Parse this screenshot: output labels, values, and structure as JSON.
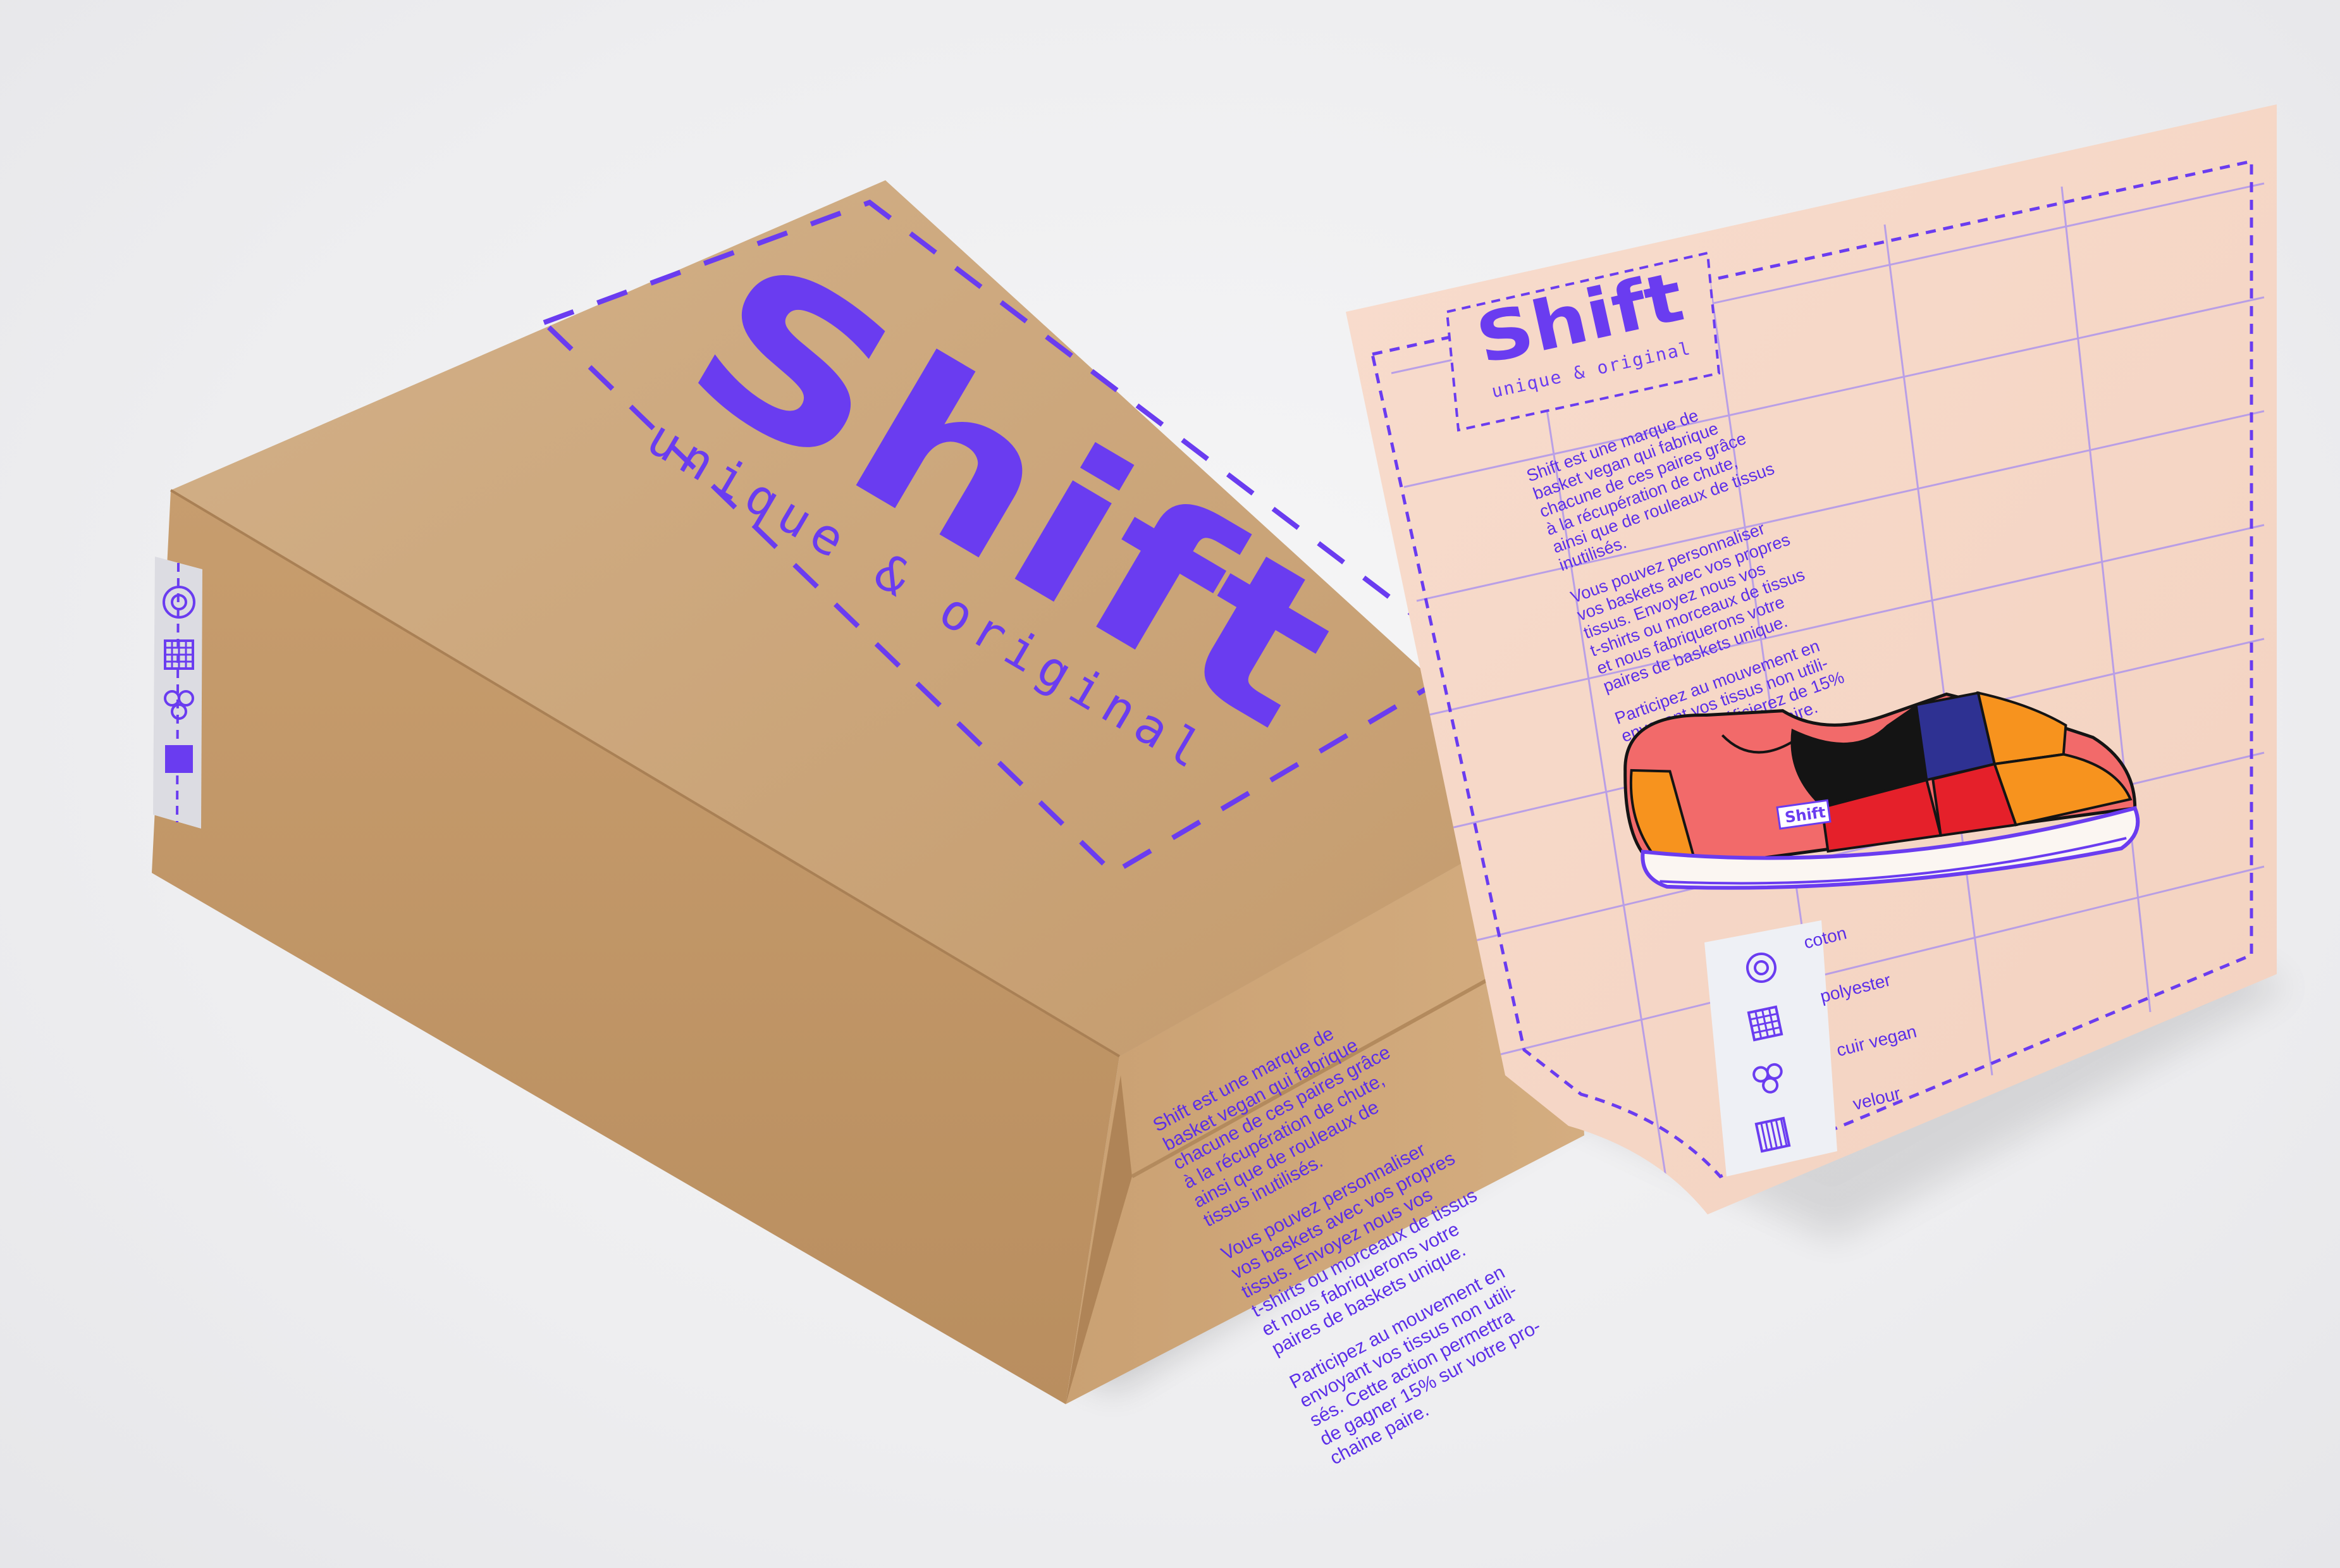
{
  "brand": {
    "name": "Shift",
    "tagline": "unique & original"
  },
  "box": {
    "side_text_paragraphs": [
      [
        "Shift est une marque de",
        "basket vegan qui fabrique",
        "chacune de ces paires grâce",
        "à la récupération de chute,",
        "ainsi que de rouleaux de",
        "tissus inutilisés."
      ],
      [
        "Vous pouvez personnaliser",
        "vos baskets avec vos propres",
        "tissus. Envoyez nous vos",
        "t-shirts ou morceaux de tissus",
        "et nous fabriquerons votre",
        "paires de baskets unique."
      ],
      [
        "Participez au mouvement en",
        "envoyant vos tissus non utili-",
        "sés. Cette action permettra",
        "de gagner 15% sur votre pro-",
        "chaine paire."
      ]
    ]
  },
  "card": {
    "paragraphs": [
      [
        "Shift est une marque de",
        "basket vegan qui fabrique",
        "chacune de ces paires grâce",
        "à la récupération de chute,",
        "ainsi que de rouleaux de tissus",
        "inutilisés."
      ],
      [
        "Vous pouvez personnaliser",
        "vos baskets avec vos propres",
        "tissus. Envoyez nous vos",
        "t-shirts ou morceaux de tissus",
        "et nous fabriquerons votre",
        "paires de baskets unique."
      ],
      [
        "Participez au mouvement en",
        "envoyant vos tissus non utili-",
        "sés.Vous bénéficierez de 15%",
        "sur votre prochaine paire."
      ]
    ],
    "shoe_label": "Shift",
    "materials": [
      {
        "label": "coton",
        "icon": "flower-pattern-icon"
      },
      {
        "label": "polyester",
        "icon": "grid-pattern-icon"
      },
      {
        "label": "cuir vegan",
        "icon": "circles-pattern-icon"
      },
      {
        "label": "velour",
        "icon": "stripes-pattern-icon"
      }
    ]
  },
  "colors": {
    "brand_purple": "#6a3cf0",
    "cardboard": "#c9a478",
    "card_pink": "#f6d8c8",
    "shoe_coral": "#f26a6a",
    "shoe_red": "#e5202a",
    "shoe_orange": "#f7931e",
    "shoe_black": "#141414",
    "shoe_navy": "#2e3192"
  }
}
